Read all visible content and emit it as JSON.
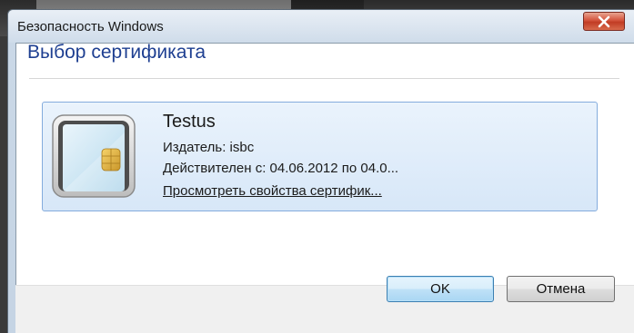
{
  "window": {
    "title": "Безопасность Windows",
    "close_icon": "close-icon"
  },
  "dialog": {
    "heading": "Выбор сертификата"
  },
  "certificate": {
    "icon": "smart-card-icon",
    "name": "Testus",
    "issuer": "Издатель: isbc",
    "validity": "Действителен с: 04.06.2012 по 04.0...",
    "view_properties_link": "Просмотреть свойства сертифик..."
  },
  "buttons": {
    "ok_label": "OK",
    "cancel_label": "Отмена"
  },
  "colors": {
    "heading": "#1e3f91",
    "tile_border": "#84acdd",
    "close_button": "#c13c24"
  }
}
